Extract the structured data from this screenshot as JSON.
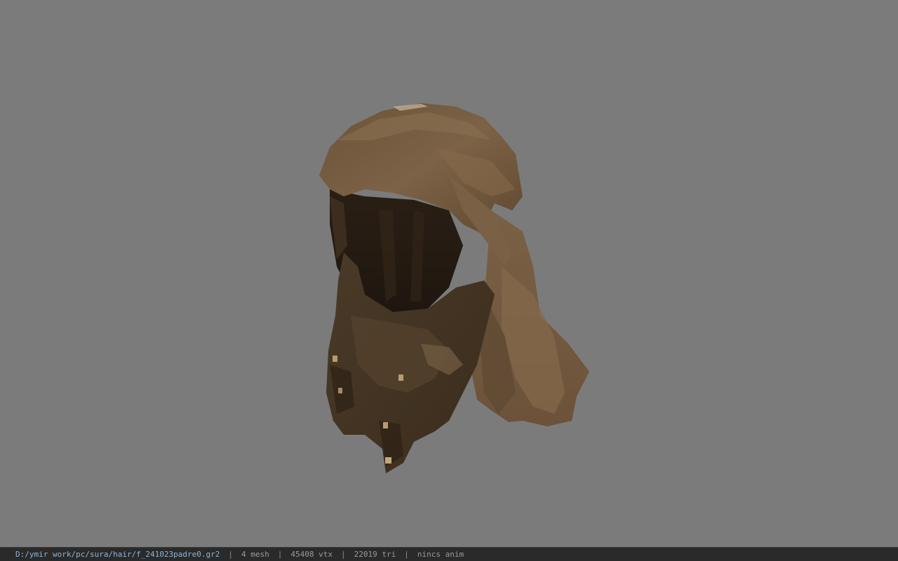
{
  "viewer": {
    "background_color": "#7b7b7b",
    "model_name": "hair mesh"
  },
  "statusbar": {
    "file_path": "D:/ymir work/pc/sura/hair/f_241023padre0.gr2",
    "mesh_count": "4 mesh",
    "vertex_count": "45408 vtx",
    "triangle_count": "22019 tri",
    "animation": "nincs anim",
    "separator": "|"
  }
}
